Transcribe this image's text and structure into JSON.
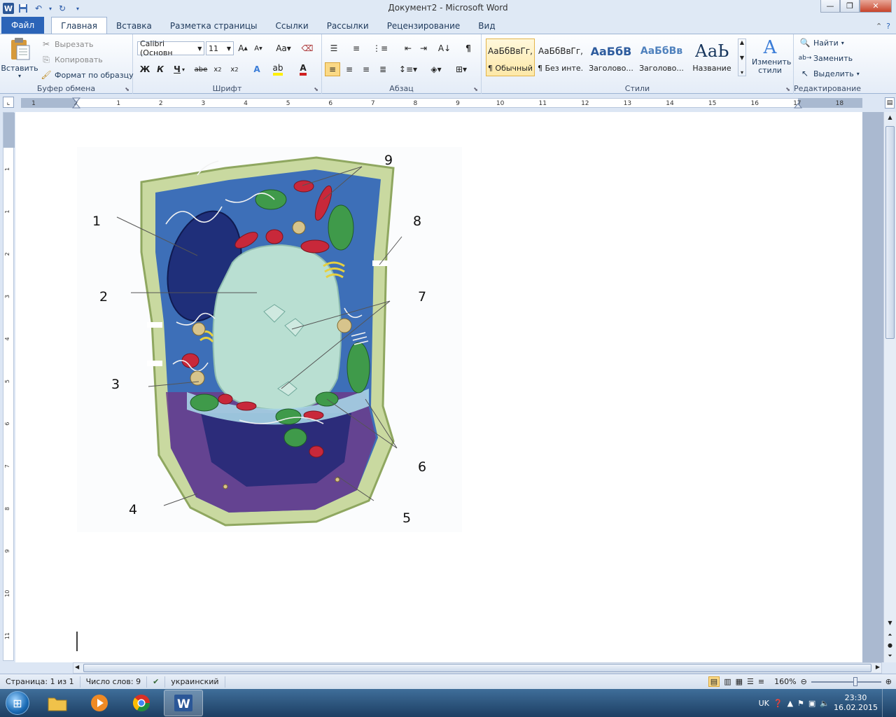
{
  "window": {
    "title": "Документ2 - Microsoft Word",
    "app_letter": "W",
    "controls": {
      "minimize": "—",
      "maximize": "❐",
      "close": "✕"
    }
  },
  "tabs": [
    {
      "label": "Файл"
    },
    {
      "label": "Главная"
    },
    {
      "label": "Вставка"
    },
    {
      "label": "Разметка страницы"
    },
    {
      "label": "Ссылки"
    },
    {
      "label": "Рассылки"
    },
    {
      "label": "Рецензирование"
    },
    {
      "label": "Вид"
    }
  ],
  "ribbon": {
    "clipboard": {
      "group_label": "Буфер обмена",
      "paste": "Вставить",
      "cut": "Вырезать",
      "copy": "Копировать",
      "format_painter": "Формат по образцу"
    },
    "font": {
      "group_label": "Шрифт",
      "font_name": "Calibri (Основн",
      "font_size": "11",
      "bold": "Ж",
      "italic": "К",
      "underline": "Ч",
      "strike": "abe"
    },
    "paragraph": {
      "group_label": "Абзац",
      "pilcrow": "¶"
    },
    "styles": {
      "group_label": "Стили",
      "items": [
        {
          "preview": "АаБбВвГг,",
          "name": "¶ Обычный"
        },
        {
          "preview": "АаБбВвГг,",
          "name": "¶ Без инте..."
        },
        {
          "preview": "АаБбВ",
          "name": "Заголово..."
        },
        {
          "preview": "АаБбВв",
          "name": "Заголово..."
        },
        {
          "preview": "АаЬ",
          "name": "Название"
        }
      ],
      "change_styles": "Изменить стили"
    },
    "editing": {
      "group_label": "Редактирование",
      "find": "Найти",
      "replace": "Заменить",
      "select": "Выделить"
    }
  },
  "ruler": {
    "numbers": [
      "1",
      "2",
      "1",
      "2",
      "3",
      "4",
      "5",
      "6",
      "7",
      "8",
      "9",
      "10",
      "11",
      "12",
      "13",
      "14",
      "15",
      "16",
      "17",
      "18"
    ],
    "vnumbers": [
      "1",
      "1",
      "2",
      "3",
      "4",
      "5",
      "6",
      "7",
      "8",
      "9",
      "10",
      "11"
    ]
  },
  "diagram": {
    "labels": [
      "1",
      "2",
      "3",
      "4",
      "5",
      "6",
      "7",
      "8",
      "9"
    ]
  },
  "status": {
    "page": "Страница: 1 из 1",
    "words": "Число слов: 9",
    "language": "украинский",
    "zoom": "160%"
  },
  "taskbar": {
    "lang": "UK",
    "time": "23:30",
    "date": "16.02.2015"
  },
  "colors": {
    "ribbon_blue": "#2b64b8",
    "cell_wall": "#c9d9a0",
    "cytoplasm": "#3d6fb8",
    "vacuole": "#b9dfd2",
    "nucleus": "#1f2f7a",
    "chloroplast": "#3f9a4a",
    "mitochondria": "#c8283a"
  }
}
